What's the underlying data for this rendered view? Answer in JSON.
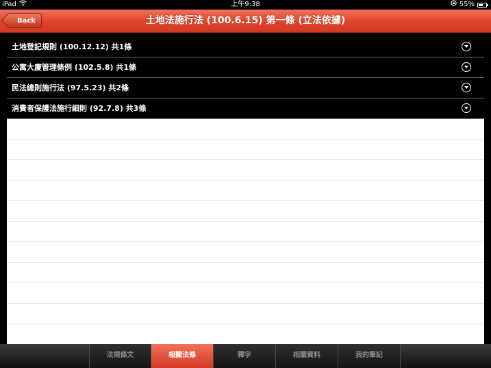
{
  "status": {
    "device": "iPad",
    "time": "上午9:38",
    "battery": "55%",
    "battery_level": 0.55
  },
  "nav": {
    "back_label": "Back",
    "title": "土地法施行法 (100.6.15) 第一條 (立法依據)"
  },
  "laws": [
    {
      "label": "土地登記規則 (100.12.12) 共1條"
    },
    {
      "label": "公寓大廈管理條例 (102.5.8) 共1條"
    },
    {
      "label": "民法總則施行法 (97.5.23) 共2條"
    },
    {
      "label": "消費者保護法施行細則 (92.7.8) 共3條"
    }
  ],
  "tabs": [
    {
      "label": "法規條文",
      "active": false
    },
    {
      "label": "相關法條",
      "active": true
    },
    {
      "label": "釋字",
      "active": false
    },
    {
      "label": "相關資料",
      "active": false
    },
    {
      "label": "我的筆記",
      "active": false
    }
  ],
  "colors": {
    "accent": "#e0452b",
    "row_background": "#000000"
  }
}
